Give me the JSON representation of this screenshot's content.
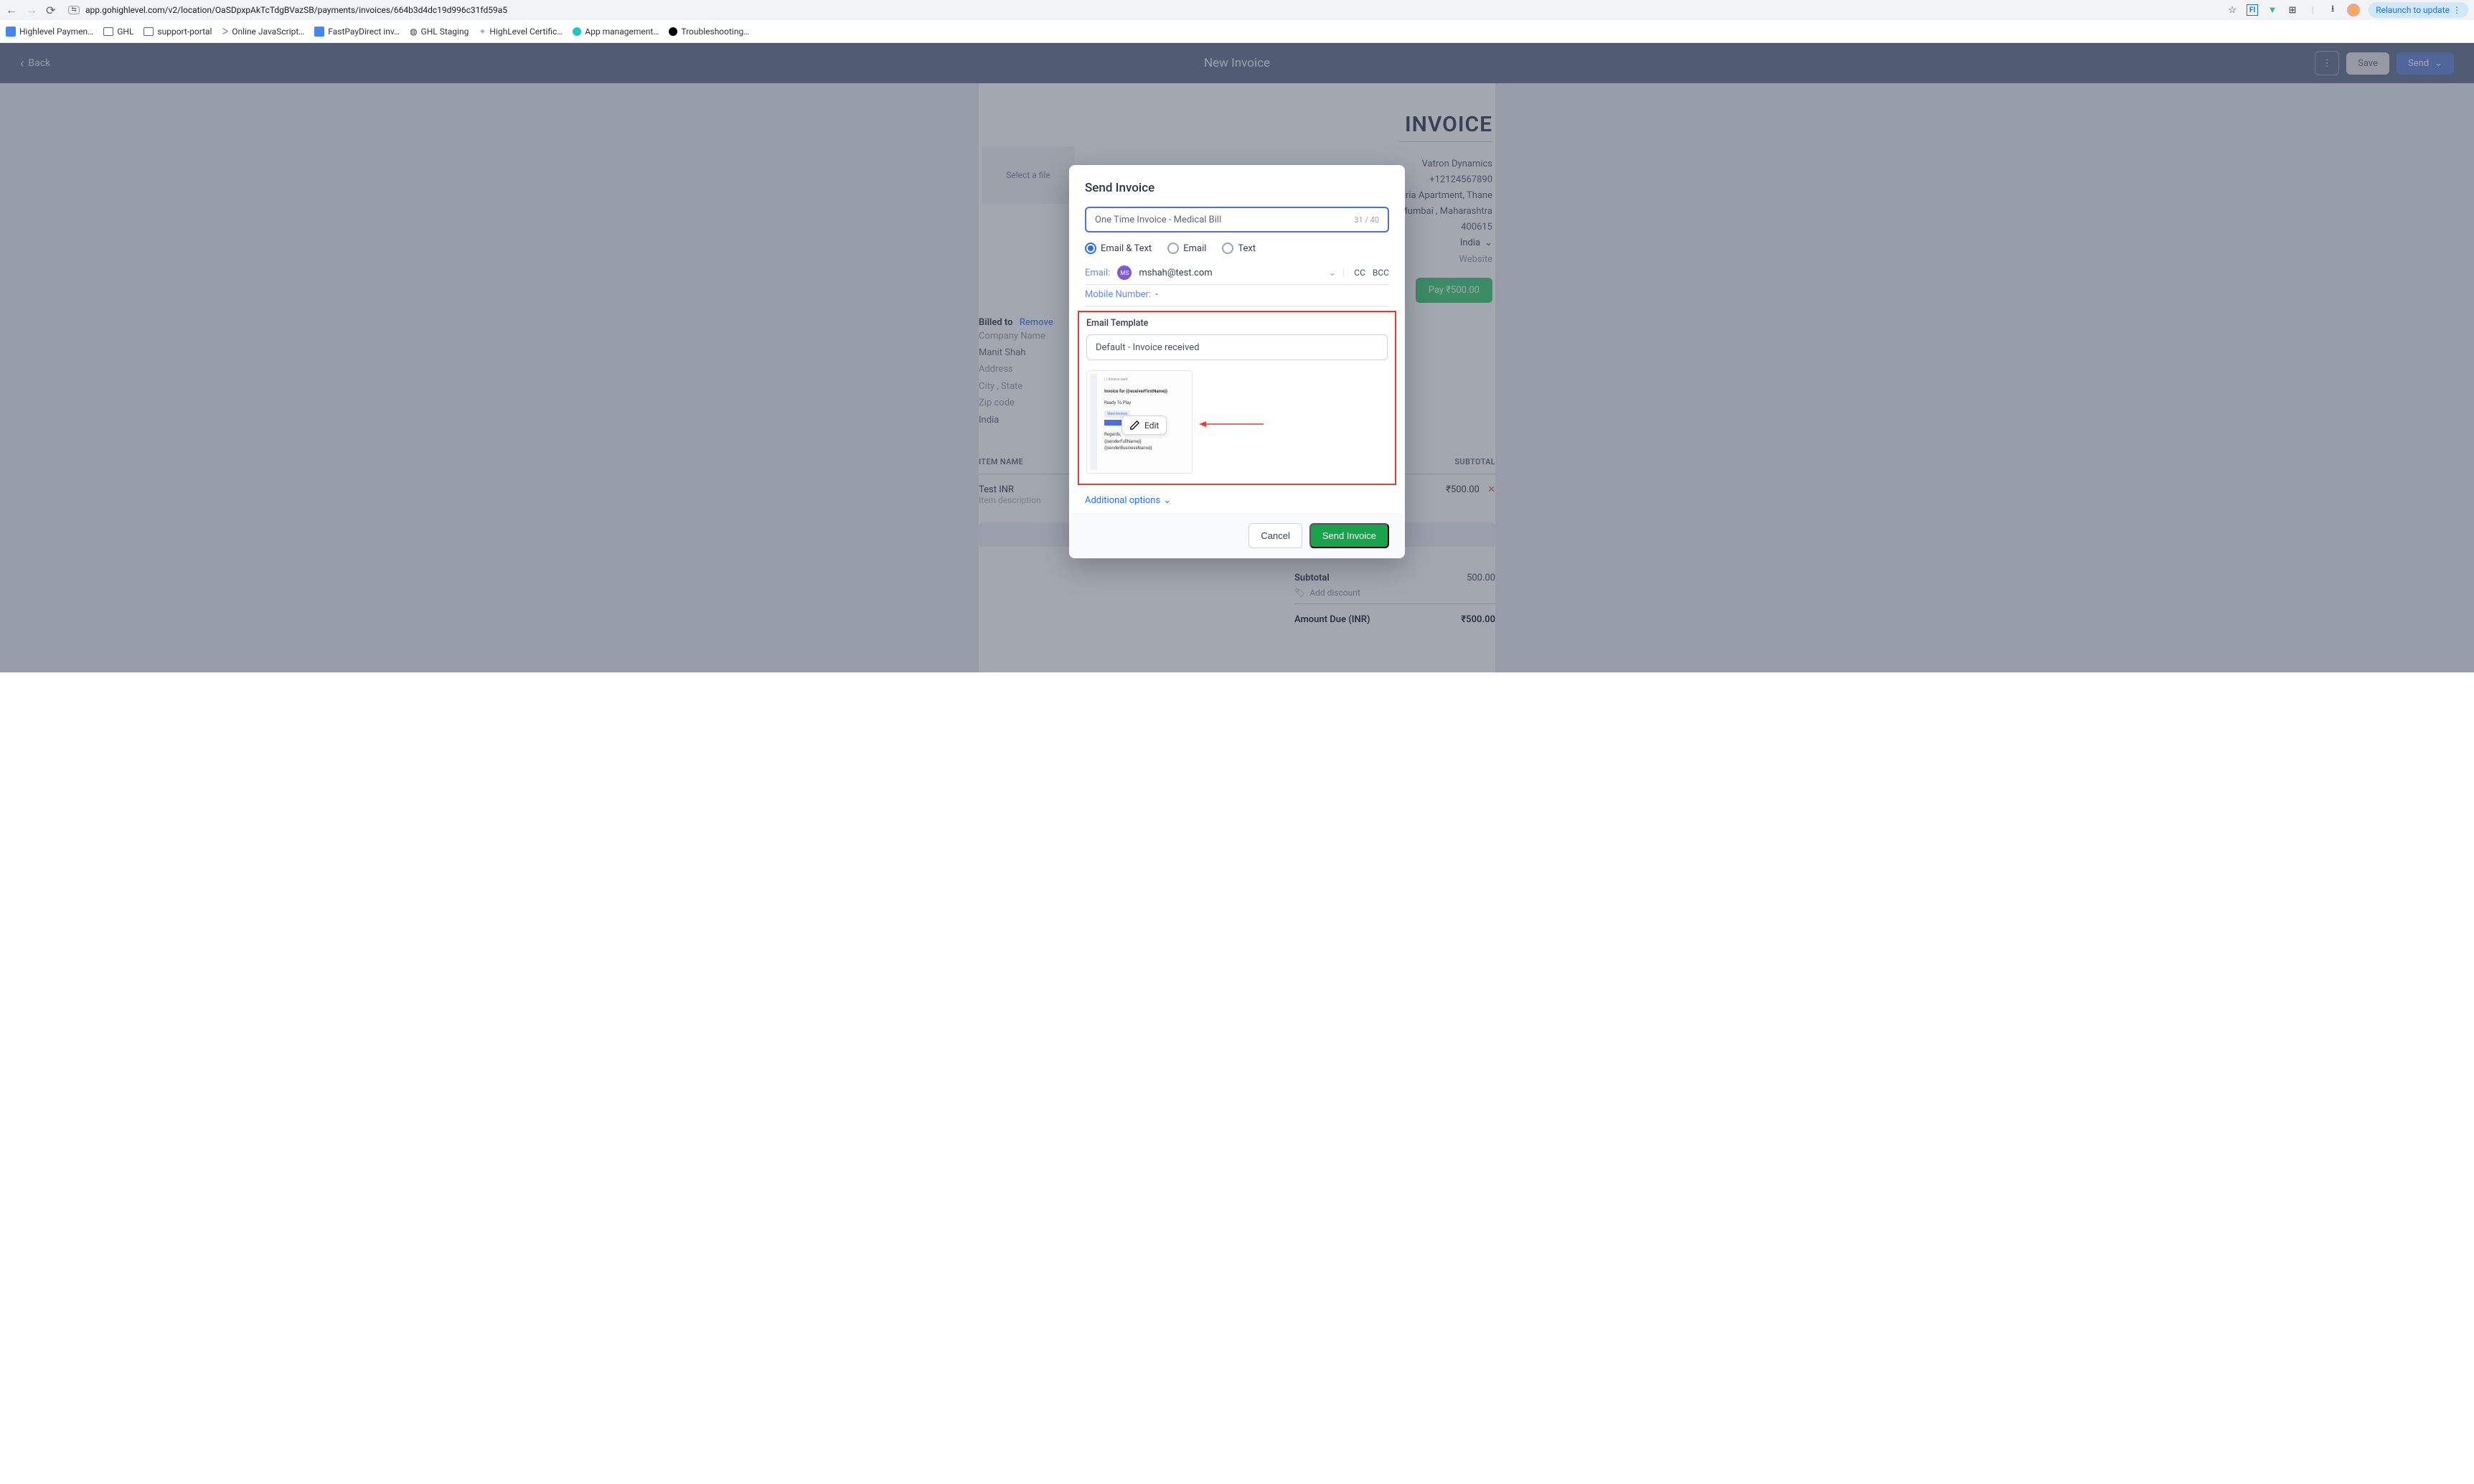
{
  "browser": {
    "url": "app.gohighlevel.com/v2/location/OaSDpxpAkTcTdgBVazSB/payments/invoices/664b3d4dc19d996c31fd59a5",
    "relaunch": "Relaunch to update"
  },
  "bookmarks": [
    {
      "label": "Highlevel Paymen…"
    },
    {
      "label": "GHL"
    },
    {
      "label": "support-portal"
    },
    {
      "label": "Online JavaScript…"
    },
    {
      "label": "FastPayDirect inv…"
    },
    {
      "label": "GHL Staging"
    },
    {
      "label": "HighLevel Certific…"
    },
    {
      "label": "App management…"
    },
    {
      "label": "Troubleshooting…"
    }
  ],
  "header": {
    "back": "Back",
    "title": "New Invoice",
    "save": "Save",
    "send": "Send"
  },
  "invoice": {
    "title": "INVOICE",
    "logo_placeholder": "Select a file",
    "company": {
      "name": "Vatron Dynamics",
      "phone": "+12124567890",
      "addr1": "oria Apartment, Thane",
      "addr2": "Mumbai ,  Maharashtra",
      "zip": "400615",
      "country": "India",
      "website": "Website"
    },
    "pay_button": "Pay ₹500.00",
    "billed": {
      "title": "Billed to",
      "remove": "Remove",
      "company": "Company Name",
      "name": "Manit Shah",
      "address": "Address",
      "citystate": "City  , State",
      "zip": "Zip code",
      "country": "India"
    },
    "items_header": {
      "name": "ITEM NAME",
      "subtotal": "SUBTOTAL"
    },
    "items": [
      {
        "name": "Test INR",
        "desc": "Item description",
        "subtotal": "₹500.00"
      }
    ],
    "totals": {
      "subtotal_label": "Subtotal",
      "subtotal_val": "500.00",
      "add_discount": "Add discount",
      "due_label": "Amount Due (INR)",
      "due_val": "₹500.00"
    }
  },
  "modal": {
    "title": "Send Invoice",
    "subject": "One Time Invoice - Medical Bill",
    "char_count": "31 / 40",
    "channels": {
      "both": "Email & Text",
      "email": "Email",
      "text": "Text"
    },
    "email_label": "Email:",
    "avatar_initials": "MS",
    "email_value": "mshah@test.com",
    "cc": "CC",
    "bcc": "BCC",
    "mobile_label": "Mobile Number:",
    "mobile_value": "-",
    "template_label": "Email Template",
    "template_value": "Default - Invoice received",
    "preview": {
      "line1": "Invoice for {{receiverFirstName}}",
      "line2": "Ready To Play",
      "sub": "View Invoice",
      "reg": "Regards,",
      "sender1": "{{senderFullName}}",
      "sender2": "{{senderBusinessName}}"
    },
    "edit": "Edit",
    "additional": "Additional options",
    "cancel": "Cancel",
    "send": "Send Invoice"
  }
}
